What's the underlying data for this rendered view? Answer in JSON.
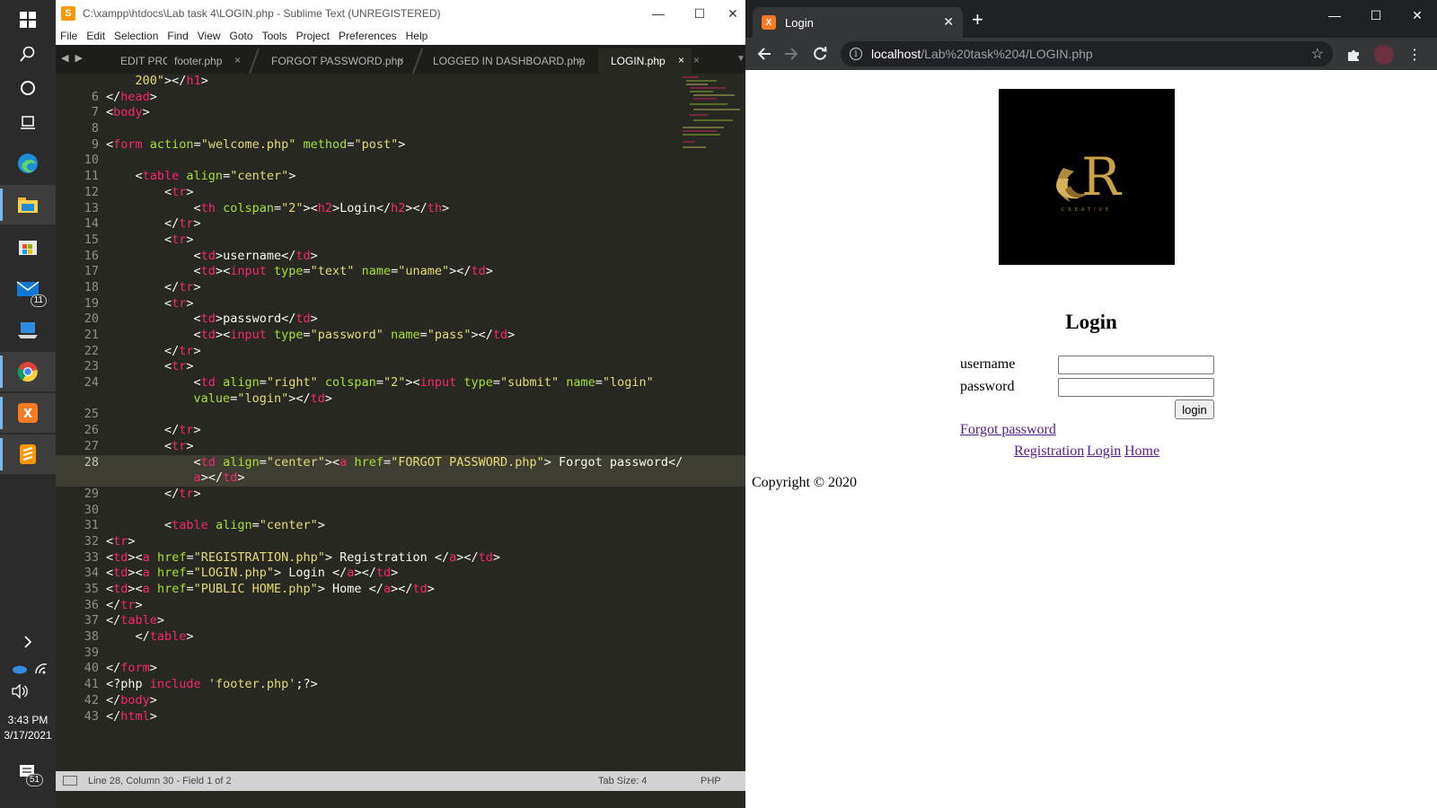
{
  "taskbar": {
    "mail_badge": "11",
    "time": "3:43 PM",
    "date": "3/17/2021",
    "notifications_badge": "51"
  },
  "sublime": {
    "title": "C:\\xampp\\htdocs\\Lab task 4\\LOGIN.php - Sublime Text (UNREGISTERED)",
    "menu": [
      "File",
      "Edit",
      "Selection",
      "Find",
      "View",
      "Goto",
      "Tools",
      "Project",
      "Preferences",
      "Help"
    ],
    "tabs": [
      "EDIT PRO",
      "footer.php",
      "FORGOT PASSWORD.php",
      "LOGGED IN DASHBOARD.php",
      "LOGIN.php"
    ],
    "active_tab": "LOGIN.php",
    "lines": [
      {
        "n": "",
        "tokens": [
          [
            "    ",
            "w"
          ],
          [
            "200\"",
            "s"
          ],
          [
            ">",
            "w"
          ],
          [
            "</",
            "w"
          ],
          [
            "h1",
            "t"
          ],
          [
            ">",
            "w"
          ]
        ]
      },
      {
        "n": "6",
        "tokens": [
          [
            "</",
            "w"
          ],
          [
            "head",
            "t"
          ],
          [
            ">",
            "w"
          ]
        ]
      },
      {
        "n": "7",
        "tokens": [
          [
            "<",
            "w"
          ],
          [
            "body",
            "t"
          ],
          [
            ">",
            "w"
          ]
        ]
      },
      {
        "n": "8",
        "tokens": []
      },
      {
        "n": "9",
        "tokens": [
          [
            "<",
            "w"
          ],
          [
            "form",
            "t"
          ],
          [
            " ",
            "w"
          ],
          [
            "action",
            "a"
          ],
          [
            "=",
            "w"
          ],
          [
            "\"welcome.php\"",
            "s"
          ],
          [
            " ",
            "w"
          ],
          [
            "method",
            "a"
          ],
          [
            "=",
            "w"
          ],
          [
            "\"post\"",
            "s"
          ],
          [
            ">",
            "w"
          ]
        ]
      },
      {
        "n": "10",
        "tokens": []
      },
      {
        "n": "11",
        "tokens": [
          [
            "    <",
            "w"
          ],
          [
            "table",
            "t"
          ],
          [
            " ",
            "w"
          ],
          [
            "align",
            "a"
          ],
          [
            "=",
            "w"
          ],
          [
            "\"center\"",
            "s"
          ],
          [
            ">",
            "w"
          ]
        ]
      },
      {
        "n": "12",
        "tokens": [
          [
            "        <",
            "w"
          ],
          [
            "tr",
            "t"
          ],
          [
            ">",
            "w"
          ]
        ]
      },
      {
        "n": "13",
        "tokens": [
          [
            "            <",
            "w"
          ],
          [
            "th",
            "t"
          ],
          [
            " ",
            "w"
          ],
          [
            "colspan",
            "a"
          ],
          [
            "=",
            "w"
          ],
          [
            "\"2\"",
            "s"
          ],
          [
            "><",
            "w"
          ],
          [
            "h2",
            "t"
          ],
          [
            ">Login</",
            "w"
          ],
          [
            "h2",
            "t"
          ],
          [
            "></",
            "w"
          ],
          [
            "th",
            "t"
          ],
          [
            ">",
            "w"
          ]
        ]
      },
      {
        "n": "14",
        "tokens": [
          [
            "        </",
            "w"
          ],
          [
            "tr",
            "t"
          ],
          [
            ">",
            "w"
          ]
        ]
      },
      {
        "n": "15",
        "tokens": [
          [
            "        <",
            "w"
          ],
          [
            "tr",
            "t"
          ],
          [
            ">",
            "w"
          ]
        ]
      },
      {
        "n": "16",
        "tokens": [
          [
            "            <",
            "w"
          ],
          [
            "td",
            "t"
          ],
          [
            ">username</",
            "w"
          ],
          [
            "td",
            "t"
          ],
          [
            ">",
            "w"
          ]
        ]
      },
      {
        "n": "17",
        "tokens": [
          [
            "            <",
            "w"
          ],
          [
            "td",
            "t"
          ],
          [
            "><",
            "w"
          ],
          [
            "input",
            "t"
          ],
          [
            " ",
            "w"
          ],
          [
            "type",
            "a"
          ],
          [
            "=",
            "w"
          ],
          [
            "\"text\"",
            "s"
          ],
          [
            " ",
            "w"
          ],
          [
            "name",
            "a"
          ],
          [
            "=",
            "w"
          ],
          [
            "\"uname\"",
            "s"
          ],
          [
            "></",
            "w"
          ],
          [
            "td",
            "t"
          ],
          [
            ">",
            "w"
          ]
        ]
      },
      {
        "n": "18",
        "tokens": [
          [
            "        </",
            "w"
          ],
          [
            "tr",
            "t"
          ],
          [
            ">",
            "w"
          ]
        ]
      },
      {
        "n": "19",
        "tokens": [
          [
            "        <",
            "w"
          ],
          [
            "tr",
            "t"
          ],
          [
            ">",
            "w"
          ]
        ]
      },
      {
        "n": "20",
        "tokens": [
          [
            "            <",
            "w"
          ],
          [
            "td",
            "t"
          ],
          [
            ">password</",
            "w"
          ],
          [
            "td",
            "t"
          ],
          [
            ">",
            "w"
          ]
        ]
      },
      {
        "n": "21",
        "tokens": [
          [
            "            <",
            "w"
          ],
          [
            "td",
            "t"
          ],
          [
            "><",
            "w"
          ],
          [
            "input",
            "t"
          ],
          [
            " ",
            "w"
          ],
          [
            "type",
            "a"
          ],
          [
            "=",
            "w"
          ],
          [
            "\"password\"",
            "s"
          ],
          [
            " ",
            "w"
          ],
          [
            "name",
            "a"
          ],
          [
            "=",
            "w"
          ],
          [
            "\"pass\"",
            "s"
          ],
          [
            "></",
            "w"
          ],
          [
            "td",
            "t"
          ],
          [
            ">",
            "w"
          ]
        ]
      },
      {
        "n": "22",
        "tokens": [
          [
            "        </",
            "w"
          ],
          [
            "tr",
            "t"
          ],
          [
            ">",
            "w"
          ]
        ]
      },
      {
        "n": "23",
        "tokens": [
          [
            "        <",
            "w"
          ],
          [
            "tr",
            "t"
          ],
          [
            ">",
            "w"
          ]
        ]
      },
      {
        "n": "24",
        "tokens": [
          [
            "            <",
            "w"
          ],
          [
            "td",
            "t"
          ],
          [
            " ",
            "w"
          ],
          [
            "align",
            "a"
          ],
          [
            "=",
            "w"
          ],
          [
            "\"right\"",
            "s"
          ],
          [
            " ",
            "w"
          ],
          [
            "colspan",
            "a"
          ],
          [
            "=",
            "w"
          ],
          [
            "\"2\"",
            "s"
          ],
          [
            "><",
            "w"
          ],
          [
            "input",
            "t"
          ],
          [
            " ",
            "w"
          ],
          [
            "type",
            "a"
          ],
          [
            "=",
            "w"
          ],
          [
            "\"submit\"",
            "s"
          ],
          [
            " ",
            "w"
          ],
          [
            "name",
            "a"
          ],
          [
            "=",
            "w"
          ],
          [
            "\"login\"",
            "s"
          ],
          [
            "\n            ",
            "w"
          ],
          [
            "value",
            "a"
          ],
          [
            "=",
            "w"
          ],
          [
            "\"login\"",
            "s"
          ],
          [
            "></",
            "w"
          ],
          [
            "td",
            "t"
          ],
          [
            ">",
            "w"
          ]
        ]
      },
      {
        "n": "25",
        "tokens": []
      },
      {
        "n": "26",
        "tokens": [
          [
            "        </",
            "w"
          ],
          [
            "tr",
            "t"
          ],
          [
            ">",
            "w"
          ]
        ]
      },
      {
        "n": "27",
        "tokens": [
          [
            "        <",
            "w"
          ],
          [
            "tr",
            "t"
          ],
          [
            ">",
            "w"
          ]
        ]
      },
      {
        "n": "28",
        "tokens": [
          [
            "            <",
            "w"
          ],
          [
            "td",
            "t"
          ],
          [
            " ",
            "w"
          ],
          [
            "align",
            "a"
          ],
          [
            "=",
            "w"
          ],
          [
            "\"center\"",
            "s"
          ],
          [
            "><",
            "w"
          ],
          [
            "a",
            "t"
          ],
          [
            " ",
            "w"
          ],
          [
            "href",
            "a"
          ],
          [
            "=",
            "w"
          ],
          [
            "\"FORGOT PASSWORD.php\"",
            "s"
          ],
          [
            "> Forgot password</",
            "w"
          ],
          [
            "\n            ",
            "w"
          ],
          [
            "a",
            "t"
          ],
          [
            "></",
            "w"
          ],
          [
            "td",
            "t"
          ],
          [
            ">",
            "w"
          ]
        ]
      },
      {
        "n": "29",
        "tokens": [
          [
            "        </",
            "w"
          ],
          [
            "tr",
            "t"
          ],
          [
            ">",
            "w"
          ]
        ]
      },
      {
        "n": "30",
        "tokens": []
      },
      {
        "n": "31",
        "tokens": [
          [
            "        <",
            "w"
          ],
          [
            "table",
            "t"
          ],
          [
            " ",
            "w"
          ],
          [
            "align",
            "a"
          ],
          [
            "=",
            "w"
          ],
          [
            "\"center\"",
            "s"
          ],
          [
            ">",
            "w"
          ]
        ]
      },
      {
        "n": "32",
        "tokens": [
          [
            "<",
            "w"
          ],
          [
            "tr",
            "t"
          ],
          [
            ">",
            "w"
          ]
        ]
      },
      {
        "n": "33",
        "tokens": [
          [
            "<",
            "w"
          ],
          [
            "td",
            "t"
          ],
          [
            "><",
            "w"
          ],
          [
            "a",
            "t"
          ],
          [
            " ",
            "w"
          ],
          [
            "href",
            "a"
          ],
          [
            "=",
            "w"
          ],
          [
            "\"REGISTRATION.php\"",
            "s"
          ],
          [
            "> Registration </",
            "w"
          ],
          [
            "a",
            "t"
          ],
          [
            "></",
            "w"
          ],
          [
            "td",
            "t"
          ],
          [
            ">",
            "w"
          ]
        ]
      },
      {
        "n": "34",
        "tokens": [
          [
            "<",
            "w"
          ],
          [
            "td",
            "t"
          ],
          [
            "><",
            "w"
          ],
          [
            "a",
            "t"
          ],
          [
            " ",
            "w"
          ],
          [
            "href",
            "a"
          ],
          [
            "=",
            "w"
          ],
          [
            "\"LOGIN.php\"",
            "s"
          ],
          [
            "> Login </",
            "w"
          ],
          [
            "a",
            "t"
          ],
          [
            "></",
            "w"
          ],
          [
            "td",
            "t"
          ],
          [
            ">",
            "w"
          ]
        ]
      },
      {
        "n": "35",
        "tokens": [
          [
            "<",
            "w"
          ],
          [
            "td",
            "t"
          ],
          [
            "><",
            "w"
          ],
          [
            "a",
            "t"
          ],
          [
            " ",
            "w"
          ],
          [
            "href",
            "a"
          ],
          [
            "=",
            "w"
          ],
          [
            "\"PUBLIC HOME.php\"",
            "s"
          ],
          [
            "> Home </",
            "w"
          ],
          [
            "a",
            "t"
          ],
          [
            "></",
            "w"
          ],
          [
            "td",
            "t"
          ],
          [
            ">",
            "w"
          ]
        ]
      },
      {
        "n": "36",
        "tokens": [
          [
            "</",
            "w"
          ],
          [
            "tr",
            "t"
          ],
          [
            ">",
            "w"
          ]
        ]
      },
      {
        "n": "37",
        "tokens": [
          [
            "</",
            "w"
          ],
          [
            "table",
            "t"
          ],
          [
            ">",
            "w"
          ]
        ]
      },
      {
        "n": "38",
        "tokens": [
          [
            "    </",
            "w"
          ],
          [
            "table",
            "t"
          ],
          [
            ">",
            "w"
          ]
        ]
      },
      {
        "n": "39",
        "tokens": []
      },
      {
        "n": "40",
        "tokens": [
          [
            "</",
            "w"
          ],
          [
            "form",
            "t"
          ],
          [
            ">",
            "w"
          ]
        ]
      },
      {
        "n": "41",
        "tokens": [
          [
            "<?php ",
            "w"
          ],
          [
            "include",
            "t"
          ],
          [
            " ",
            "w"
          ],
          [
            "'footer.php'",
            "s"
          ],
          [
            ";?>",
            "w"
          ]
        ]
      },
      {
        "n": "42",
        "tokens": [
          [
            "</",
            "w"
          ],
          [
            "body",
            "t"
          ],
          [
            ">",
            "w"
          ]
        ]
      },
      {
        "n": "43",
        "tokens": [
          [
            "</",
            "w"
          ],
          [
            "html",
            "t"
          ],
          [
            ">",
            "w"
          ]
        ]
      }
    ],
    "current_line": "28",
    "status_left": "Line 28, Column 30 - Field 1 of 2",
    "status_tab_size": "Tab Size: 4",
    "status_syntax": "PHP",
    "colors": {
      "tag": "#f92672",
      "attr": "#a6e22e",
      "string": "#e6db74",
      "text": "#f8f8f2"
    }
  },
  "chrome": {
    "tab_title": "Login",
    "url_host": "localhost",
    "url_path": "/Lab%20task%204/LOGIN.php",
    "page": {
      "heading": "Login",
      "username_label": "username",
      "password_label": "password",
      "username_value": "",
      "password_value": "",
      "login_button": "login",
      "forgot_link": "Forgot password",
      "nav_links": [
        "Registration",
        "Login",
        "Home"
      ],
      "copyright": "Copyright © 2020",
      "logo_letter": "R",
      "logo_caption": "CREATIVE",
      "logo_colors": {
        "background": "#000000",
        "gold": "#c9a24a"
      }
    }
  }
}
